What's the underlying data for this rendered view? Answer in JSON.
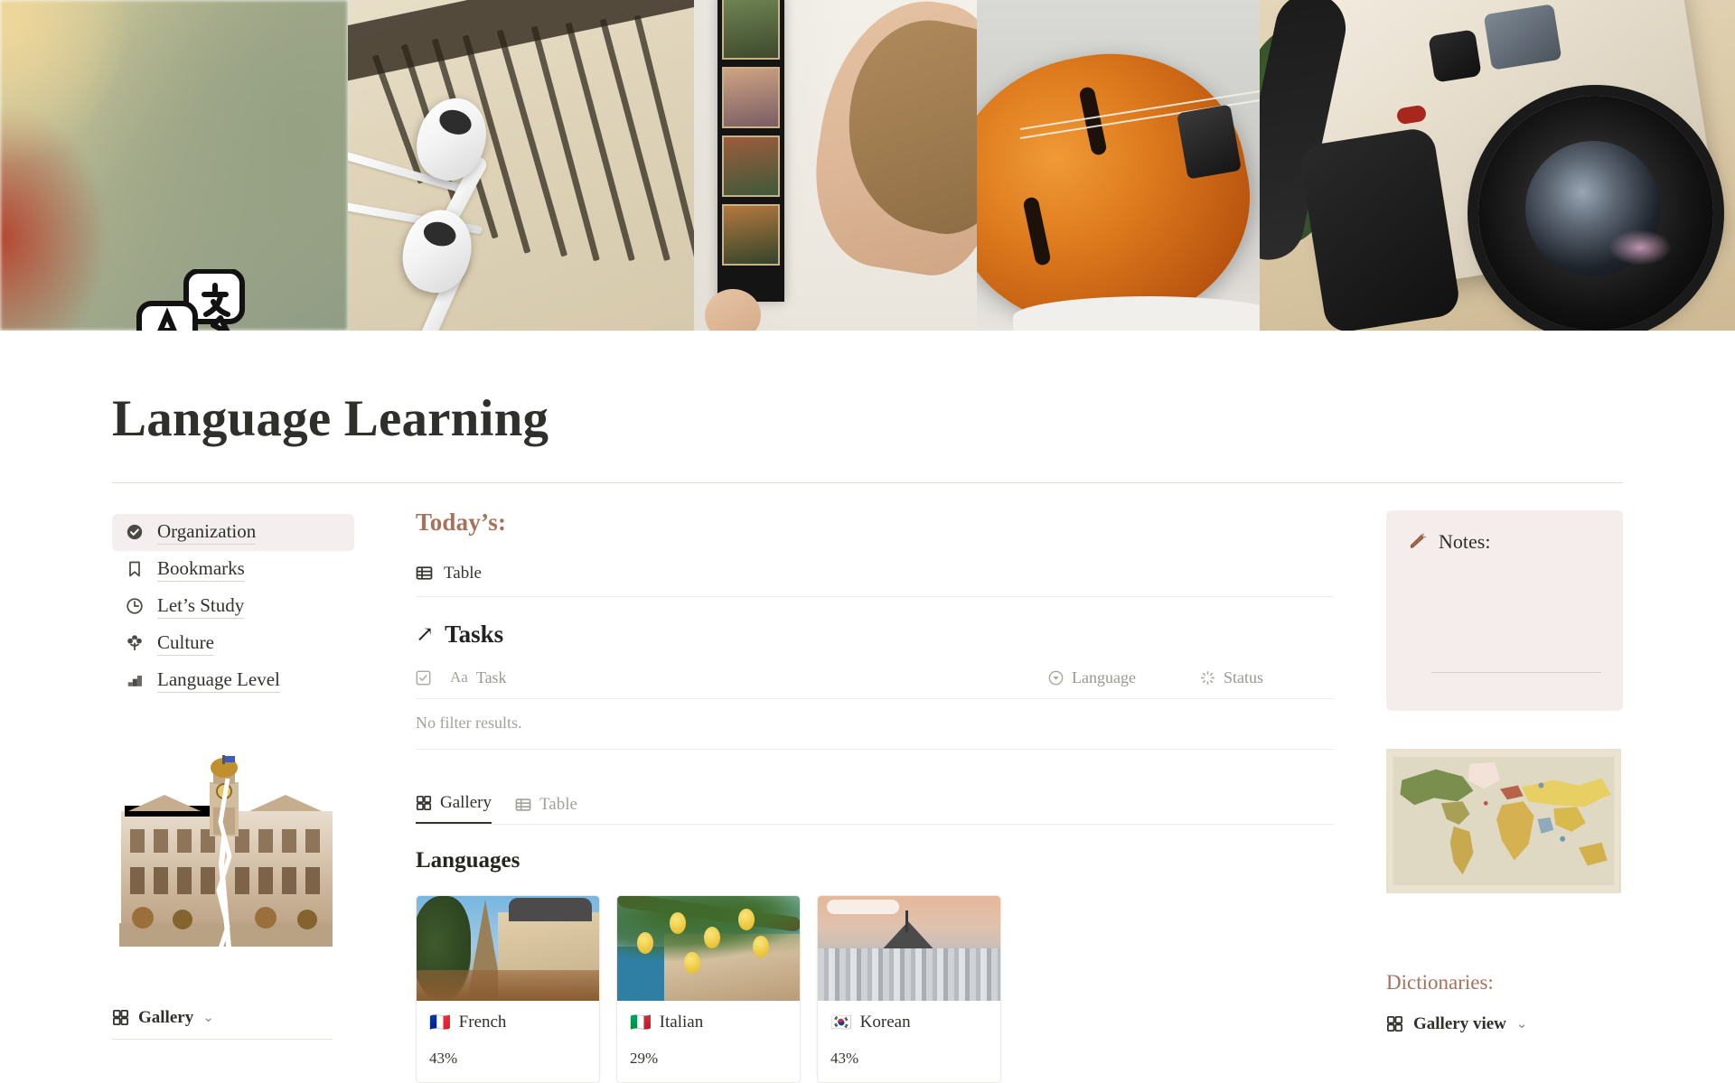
{
  "page": {
    "title": "Language Learning",
    "icon": "translate-icon"
  },
  "banner": {
    "panels": [
      {
        "name": "gradient-panel",
        "description": "blurred warm gradient"
      },
      {
        "name": "book-earbuds-photo",
        "description": "open spanish book with white earbuds"
      },
      {
        "name": "film-strip-photo",
        "description": "hand holding a photo film strip"
      },
      {
        "name": "violin-photo",
        "description": "orange violin with bow"
      },
      {
        "name": "camera-photo",
        "description": "vintage film camera, lens made in japan"
      }
    ]
  },
  "sidebar": {
    "items": [
      {
        "label": "Organization",
        "icon": "check-circle-icon",
        "active": true
      },
      {
        "label": "Bookmarks",
        "icon": "bookmark-icon",
        "active": false
      },
      {
        "label": "Let’s Study",
        "icon": "clock-icon",
        "active": false
      },
      {
        "label": "Culture",
        "icon": "flower-icon",
        "active": false
      },
      {
        "label": "Language Level",
        "icon": "bar-chart-icon",
        "active": false
      }
    ],
    "image_caption": "vintage city hall illustration",
    "gallery_label": "Gallery",
    "gallery_chevron": "⌄"
  },
  "main": {
    "todays_heading": "Today’s:",
    "table_link": {
      "label": "Table",
      "icon": "table-icon"
    },
    "tasks": {
      "arrow": "↗",
      "heading": "Tasks",
      "columns": [
        {
          "label": "Task",
          "icon": "title-aa-icon",
          "type": "title"
        },
        {
          "label": "Language",
          "icon": "select-icon",
          "type": "select"
        },
        {
          "label": "Status",
          "icon": "status-icon",
          "type": "status"
        }
      ],
      "empty_state": "No filter results."
    },
    "view_tabs": [
      {
        "label": "Gallery",
        "icon": "gallery-icon",
        "active": true
      },
      {
        "label": "Table",
        "icon": "table-icon",
        "active": false
      }
    ],
    "languages_heading": "Languages",
    "language_cards": [
      {
        "flag": "🇫🇷",
        "name": "French",
        "progress": "43%",
        "image": "eiffel-tower-photo"
      },
      {
        "flag": "🇮🇹",
        "name": "Italian",
        "progress": "29%",
        "image": "amalfi-lemons-photo"
      },
      {
        "flag": "🇰🇷",
        "name": "Korean",
        "progress": "43%",
        "image": "seoul-skyline-photo"
      }
    ]
  },
  "right": {
    "notes": {
      "title": "Notes:",
      "icon": "pencil-icon"
    },
    "map_caption": "vintage world map",
    "dictionaries_title": "Dictionaries:",
    "dictionaries_view": {
      "label": "Gallery view",
      "icon": "gallery-icon",
      "chevron": "⌄"
    }
  },
  "colors": {
    "accent": "#a9705b",
    "text": "#2f2f2b",
    "muted": "#a3a19a",
    "notes_bg": "#f4edec",
    "active_nav_bg": "#f4eeee"
  }
}
